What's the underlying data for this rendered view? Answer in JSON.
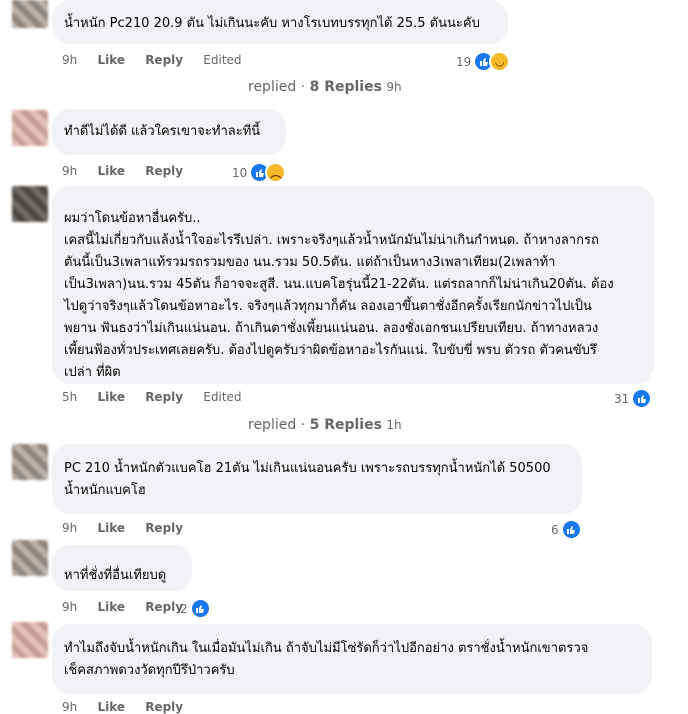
{
  "comments": [
    {
      "text": "น้ำหนัก Pc210 20.9 ตัน ไม่เกินนะคับ หางโรเบทบรรทุกได้ 25.5 ตันนะคับ",
      "time": "9h",
      "like": "Like",
      "reply": "Reply",
      "edited": "Edited",
      "reactions": "19"
    },
    {
      "text": "ทำดีไม่ได้ดี แล้วใครเขาจะทำละทีนี้",
      "time": "9h",
      "like": "Like",
      "reply": "Reply",
      "reactions": "10"
    },
    {
      "text": "ผมว่าโดนข้อหาอื่นครับ..\nเคสนี้ไม่เกี่ยวกับแล้งน้ำใจอะไรรึเปล่า. เพราะจริงๆแล้วน้ำหนักมันไม่น่าเกินกำหนด. ถ้าหางลากรถ\nตันนี้เป็น3เพลาแท้รวมรถรวมของ นน.รวม 50.5ตัน. แต่ถ้าเป็นหาง3เพลาเทียม(2เพลาท้า\nเป็น3เพลา)นน.รวม 45ตัน ก็อาจจะสูสี. นน.แบคโฮรุ่นนี้21-22ตัน. แต่รถลากก็ไม่น่าเกิน20ตัน. ต้อง\nไปดูว่าจริงๆแล้วโดนข้อหาอะไร. จริงๆแล้วทุกมาก็คัน ลองเอาขึ้นตาชั่งอีกครั้งเรียกนักข่าวไปเป็น\nพยาน ฟันธงว่าไม่เกินแน่นอน. ถ้าเกินตาชั่งเพี้ยนแน่นอน. ลองชั่งเอกชนเปรียบเทียบ. ถ้าทางหลวง\nเพี้ยนฟ้องทั่วประเทศเลยครับ. ต้องไปดูครับว่าผิดข้อหาอะไรกันแน่. ใบขับขี่ พรบ ตัวรถ ตัวคนขับรึ\nเปล่า ที่ผิด",
      "time": "5h",
      "like": "Like",
      "reply": "Reply",
      "edited": "Edited",
      "reactions": "31"
    },
    {
      "text": "PC 210 น้ำหนักตัวแบคโฮ 21ตัน ไม่เกินแน่นอนครับ เพราะรถบรรทุกน้ำหนักได้ 50500\nน้ำหนักแบคโฮ",
      "time": "9h",
      "like": "Like",
      "reply": "Reply",
      "reactions": "6"
    },
    {
      "text": "หาที่ชั่งที่อื่นเทียบดู",
      "time": "9h",
      "like": "Like",
      "reply": "Reply",
      "reactions": "2"
    },
    {
      "text": "ทำไมถึงจับน้ำหนักเกิน ในเมื่อมันไม่เกิน ถ้าจับไม่มีโซ่รัดก็ว่าไปอีกอย่าง ตราชั่งน้ำหนักเขาตรวจ\nเช็คสภาพดวงวัดทุกปีรึป่าวครับ",
      "time": "9h",
      "like": "Like",
      "reply": "Reply"
    }
  ],
  "replied_1": {
    "label": "replied",
    "count": "8 Replies",
    "time": "9h"
  },
  "replied_2": {
    "label": "replied",
    "count": "5 Replies",
    "time": "1h"
  },
  "icons": {
    "like": "like-icon",
    "haha": "haha-icon"
  },
  "colors": {
    "bubble": "#f0f2f5",
    "like_blue": "#1877f2",
    "meta_text": "#65676b"
  }
}
